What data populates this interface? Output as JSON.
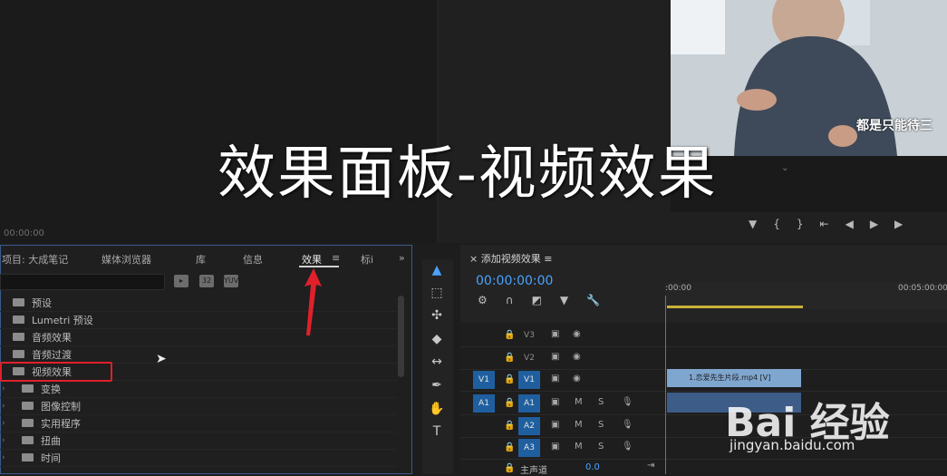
{
  "overlay_title": "效果面板-视频效果",
  "source_monitor": {
    "timecode": "00:00:00"
  },
  "program_monitor": {
    "subtitle": "都是只能待三"
  },
  "project_panel": {
    "tabs": [
      "项目: 大成笔记",
      "媒体浏览器",
      "库",
      "信息",
      "效果",
      "标i"
    ],
    "active_tab": "效果",
    "filter_buttons": [
      "32",
      "YUV"
    ],
    "tree": [
      {
        "label": "预设",
        "level": 0
      },
      {
        "label": "Lumetri 预设",
        "level": 0
      },
      {
        "label": "音频效果",
        "level": 0
      },
      {
        "label": "音频过渡",
        "level": 0
      },
      {
        "label": "视频效果",
        "level": 0
      },
      {
        "label": "变换",
        "level": 1
      },
      {
        "label": "图像控制",
        "level": 1
      },
      {
        "label": "实用程序",
        "level": 1
      },
      {
        "label": "扭曲",
        "level": 1
      },
      {
        "label": "时间",
        "level": 1
      }
    ]
  },
  "timeline": {
    "title": "添加视频效果",
    "timecode": "00:00:00:00",
    "ruler": [
      ":00:00",
      "00:05:00:00"
    ],
    "tracks": [
      {
        "source": "",
        "target": "V3",
        "type": "video"
      },
      {
        "source": "",
        "target": "V2",
        "type": "video"
      },
      {
        "source": "V1",
        "target": "V1",
        "type": "video"
      },
      {
        "source": "A1",
        "target": "A1",
        "type": "audio"
      },
      {
        "source": "",
        "target": "A2",
        "type": "audio"
      },
      {
        "source": "",
        "target": "A3",
        "type": "audio"
      }
    ],
    "clip_name": "1.恋爱先生片段.mp4 [V]",
    "master_label": "主声道",
    "master_value": "0.0"
  },
  "watermark": {
    "brand": "Bai 经验",
    "url": "jingyan.baidu.com"
  },
  "colors": {
    "accent": "#4aa3ff",
    "highlight": "#e0202a",
    "clip_video": "#7fa6cf",
    "work_area": "#c9b23a"
  }
}
